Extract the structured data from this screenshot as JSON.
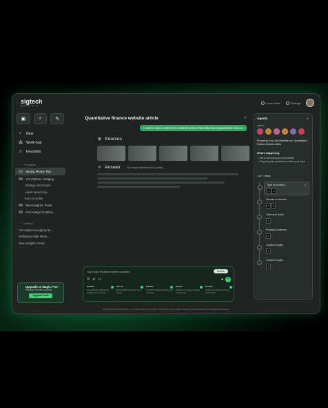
{
  "app": {
    "logo": "sigtech",
    "logo_sub": "powered by ai"
  },
  "topbar": {
    "learn": "Learn More",
    "settings": "Settings"
  },
  "sidebar": {
    "nav": [
      {
        "label": "New",
        "icon": "bell-icon"
      },
      {
        "label": "Work-hub",
        "icon": "hub-icon"
      },
      {
        "label": "Favorites",
        "icon": "star-icon"
      }
    ],
    "portfolios_heading": "Portfolios",
    "folders": [
      {
        "label": "Saving Money Tips",
        "active": true
      },
      {
        "label": "VIX Options Hedging",
        "active": false
      }
    ],
    "subitems": [
      "Strategy information",
      "Latest Speech by...",
      "Euro vs Dollar"
    ],
    "folders2": [
      "New Insights: Posts",
      "Fed Analyst Confere..."
    ],
    "history_heading": "History",
    "history": [
      "VIX Options Hedging Su...",
      "Refinance High Intere...",
      "New Insights: Posts"
    ],
    "upgrade": {
      "title": "Upgrade to Magic Pro!",
      "subtitle": "Manage unlimited projects",
      "button": "Upgrade Now"
    }
  },
  "main": {
    "title": "Quantitative finance website article",
    "user_message": "I need to write content for a website article that talks about quantitative finance",
    "sources_label": "Sources",
    "answer_label": "Answer",
    "answer_sub": "Got magic answers and guides...",
    "chat": {
      "placeholder": "Type your Finance related question",
      "model": "Normal",
      "steps": [
        {
          "title": "Enabled",
          "desc": "Generalise the ideal prices confluence from engine"
        },
        {
          "title": "Started",
          "desc": "Be Capitalized that have more tokens"
        },
        {
          "title": "Enabled",
          "desc": "Consider strategy with data types of AI help"
        },
        {
          "title": "Started",
          "desc": "Product cost detail a strategy performance"
        },
        {
          "title": "Enabled",
          "desc": "Predict your content strategy performance"
        }
      ]
    },
    "footer": "SIGTECH provides information, not financial advice, so it might not get things wrong. Always check your financial data with an independent research."
  },
  "agents": {
    "heading": "Agents",
    "agents_label": "Agents",
    "job_title": "Preparing Your Job Definition for: Quantitative finance website article",
    "whats_heading": "What's Happening:",
    "whats": [
      "We're structuring your job details",
      "Preparing key questions to refine your input"
    ],
    "step_count": "1 of 7 steps",
    "steps": [
      {
        "label": "Type of content...",
        "active": true,
        "inputs": [
          "1",
          "2"
        ]
      },
      {
        "label": "Visuals to include...",
        "active": false,
        "inputs": [
          "1",
          "2"
        ]
      },
      {
        "label": "Tone and Voice",
        "active": false,
        "inputs": [
          "1"
        ]
      },
      {
        "label": "Primary Audience",
        "active": false,
        "inputs": [
          "1"
        ]
      },
      {
        "label": "Content length",
        "active": false,
        "inputs": [
          "1"
        ]
      },
      {
        "label": "Content length",
        "active": false,
        "inputs": [
          "1"
        ]
      }
    ]
  },
  "colors": {
    "accent": "#3fd07b",
    "bg": "#1f2422",
    "panel": "#262d2a"
  }
}
